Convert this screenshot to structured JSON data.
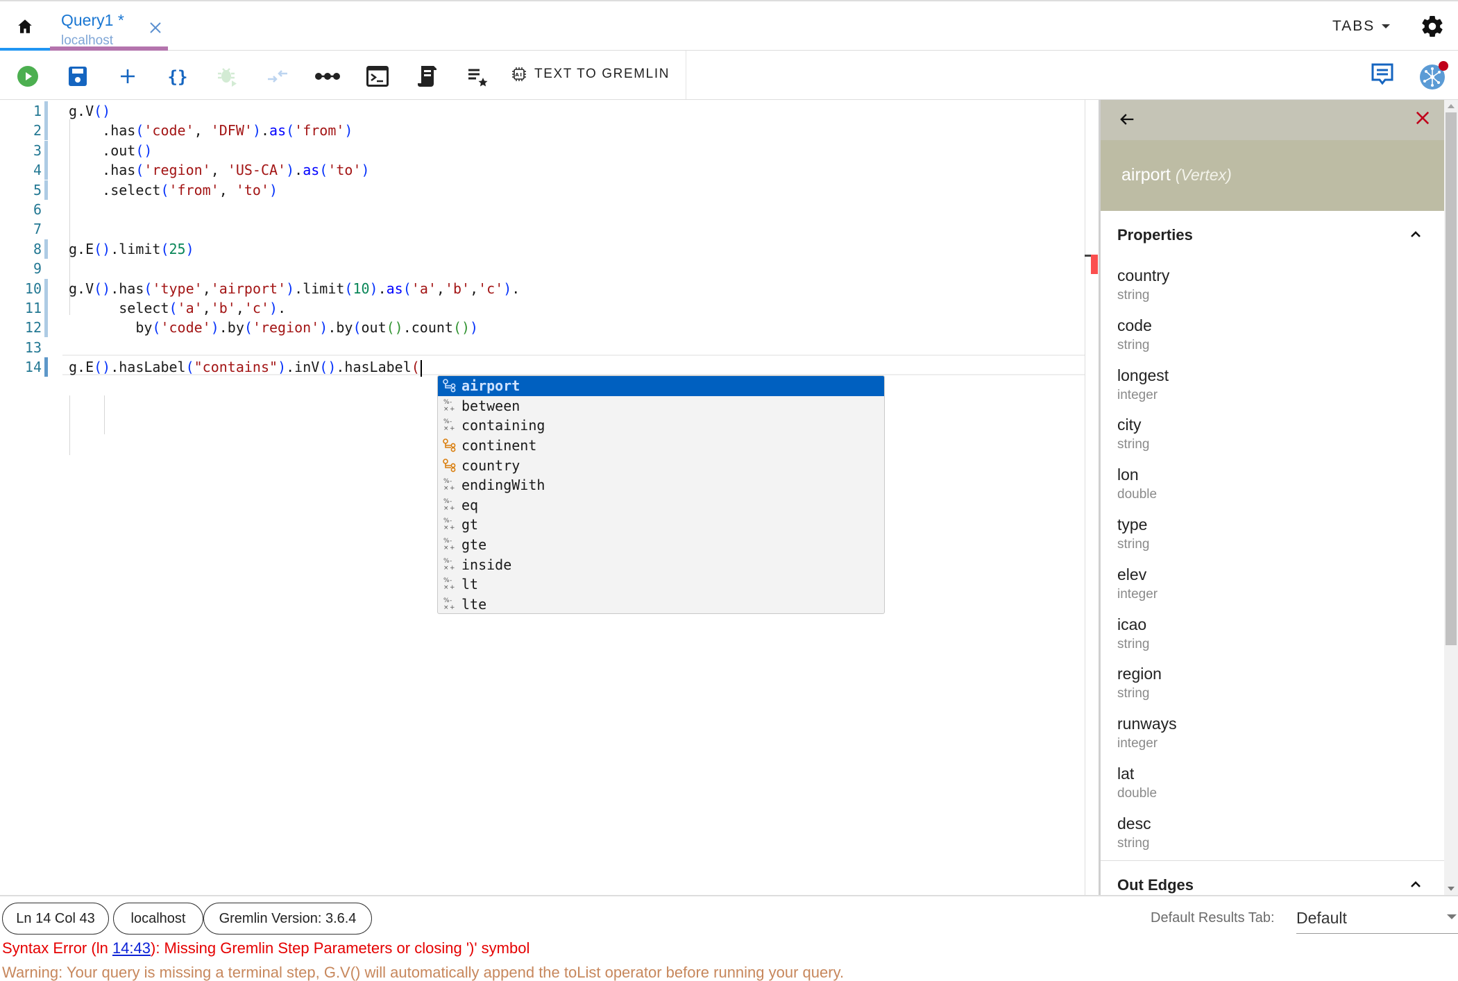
{
  "tabs": {
    "home_icon": "home-icon",
    "query_tab": {
      "title": "Query1 *",
      "subtitle": "localhost",
      "close_icon": "close-icon"
    },
    "tabs_menu_label": "TABS",
    "settings_icon": "gear-icon"
  },
  "toolbar": {
    "buttons": [
      {
        "name": "run",
        "icon": "play-circle-icon",
        "color": "#4caf50"
      },
      {
        "name": "save",
        "icon": "floppy-disk-icon",
        "color": "#1565c0"
      },
      {
        "name": "add",
        "icon": "plus-icon",
        "color": "#1565c0"
      },
      {
        "name": "format",
        "icon": "curly-braces-icon",
        "color": "#1565c0"
      },
      {
        "name": "debug",
        "icon": "bug-play-icon",
        "color": "#cfe8d0",
        "disabled": true
      },
      {
        "name": "collapse",
        "icon": "compress-arrows-icon",
        "color": "#bcd4f0",
        "disabled": true
      },
      {
        "name": "more",
        "icon": "dots-connected-icon",
        "color": "#222222"
      },
      {
        "name": "console",
        "icon": "terminal-icon",
        "color": "#222222"
      },
      {
        "name": "script",
        "icon": "scroll-icon",
        "color": "#222222"
      },
      {
        "name": "favorites",
        "icon": "list-star-icon",
        "color": "#222222"
      }
    ],
    "text_to_gremlin_label": "TEXT TO GREMLIN",
    "text_to_gremlin_icon": "ai-chip-icon",
    "feedback_icon": "chat-icon",
    "graph_icon": "graph-network-icon",
    "graph_badge_color": "#c0001a"
  },
  "editor": {
    "lines": [
      {
        "n": "1",
        "tokens": [
          [
            "g.V",
            ""
          ],
          [
            "(",
            "p1"
          ],
          [
            ")",
            "p1"
          ]
        ]
      },
      {
        "n": "2",
        "tokens": [
          [
            "    .has",
            ""
          ],
          [
            "(",
            "p1"
          ],
          [
            "'code'",
            "str"
          ],
          [
            ", ",
            ""
          ],
          [
            "'DFW'",
            "str"
          ],
          [
            ")",
            "p1"
          ],
          [
            ".",
            ""
          ],
          [
            "as",
            "fn"
          ],
          [
            "(",
            "p1"
          ],
          [
            "'from'",
            "str"
          ],
          [
            ")",
            "p1"
          ]
        ]
      },
      {
        "n": "3",
        "tokens": [
          [
            "    .out",
            ""
          ],
          [
            "(",
            "p1"
          ],
          [
            ")",
            "p1"
          ]
        ]
      },
      {
        "n": "4",
        "tokens": [
          [
            "    .has",
            ""
          ],
          [
            "(",
            "p1"
          ],
          [
            "'region'",
            "str"
          ],
          [
            ", ",
            ""
          ],
          [
            "'US-CA'",
            "str"
          ],
          [
            ")",
            "p1"
          ],
          [
            ".",
            ""
          ],
          [
            "as",
            "fn"
          ],
          [
            "(",
            "p1"
          ],
          [
            "'to'",
            "str"
          ],
          [
            ")",
            "p1"
          ]
        ]
      },
      {
        "n": "5",
        "tokens": [
          [
            "    .select",
            ""
          ],
          [
            "(",
            "p1"
          ],
          [
            "'from'",
            "str"
          ],
          [
            ", ",
            ""
          ],
          [
            "'to'",
            "str"
          ],
          [
            ")",
            "p1"
          ]
        ]
      },
      {
        "n": "6",
        "tokens": []
      },
      {
        "n": "7",
        "tokens": []
      },
      {
        "n": "8",
        "tokens": [
          [
            "g.E",
            ""
          ],
          [
            "(",
            "p1"
          ],
          [
            ")",
            "p1"
          ],
          [
            ".limit",
            ""
          ],
          [
            "(",
            "p1"
          ],
          [
            "25",
            "num"
          ],
          [
            ")",
            "p1"
          ]
        ]
      },
      {
        "n": "9",
        "tokens": []
      },
      {
        "n": "10",
        "tokens": [
          [
            "g.V",
            ""
          ],
          [
            "(",
            "p1"
          ],
          [
            ")",
            "p1"
          ],
          [
            ".has",
            ""
          ],
          [
            "(",
            "p1"
          ],
          [
            "'type'",
            "str"
          ],
          [
            ",",
            ""
          ],
          [
            "'airport'",
            "str"
          ],
          [
            ")",
            "p1"
          ],
          [
            ".limit",
            ""
          ],
          [
            "(",
            "p1"
          ],
          [
            "10",
            "num"
          ],
          [
            ")",
            "p1"
          ],
          [
            ".",
            ""
          ],
          [
            "as",
            "fn"
          ],
          [
            "(",
            "p1"
          ],
          [
            "'a'",
            "str"
          ],
          [
            ",",
            ""
          ],
          [
            "'b'",
            "str"
          ],
          [
            ",",
            ""
          ],
          [
            "'c'",
            "str"
          ],
          [
            ")",
            "p1"
          ],
          [
            ".",
            ""
          ]
        ]
      },
      {
        "n": "11",
        "tokens": [
          [
            "      select",
            ""
          ],
          [
            "(",
            "p1"
          ],
          [
            "'a'",
            "str"
          ],
          [
            ",",
            ""
          ],
          [
            "'b'",
            "str"
          ],
          [
            ",",
            ""
          ],
          [
            "'c'",
            "str"
          ],
          [
            ")",
            "p1"
          ],
          [
            ".",
            ""
          ]
        ]
      },
      {
        "n": "12",
        "tokens": [
          [
            "        by",
            ""
          ],
          [
            "(",
            "p1"
          ],
          [
            "'code'",
            "str"
          ],
          [
            ")",
            "p1"
          ],
          [
            ".by",
            ""
          ],
          [
            "(",
            "p1"
          ],
          [
            "'region'",
            "str"
          ],
          [
            ")",
            "p1"
          ],
          [
            ".by",
            ""
          ],
          [
            "(",
            "p1"
          ],
          [
            "out",
            ""
          ],
          [
            "(",
            "p2"
          ],
          [
            ")",
            "p2"
          ],
          [
            ".count",
            ""
          ],
          [
            "(",
            "p2"
          ],
          [
            ")",
            "p2"
          ],
          [
            ")",
            "p1"
          ]
        ]
      },
      {
        "n": "13",
        "tokens": []
      },
      {
        "n": "14",
        "tokens": [
          [
            "g.E",
            ""
          ],
          [
            "(",
            "p1"
          ],
          [
            ")",
            "p1"
          ],
          [
            ".hasLabel",
            ""
          ],
          [
            "(",
            "p1"
          ],
          [
            "\"contains\"",
            "str"
          ],
          [
            ")",
            "p1"
          ],
          [
            ".inV",
            ""
          ],
          [
            "(",
            "p1"
          ],
          [
            ")",
            "p1"
          ],
          [
            ".hasLabel",
            ""
          ],
          [
            "(",
            "str"
          ]
        ]
      }
    ],
    "cursor_line": "14",
    "autocomplete": [
      {
        "label": "airport",
        "kind": "label",
        "selected": true
      },
      {
        "label": "between",
        "kind": "operator"
      },
      {
        "label": "containing",
        "kind": "operator"
      },
      {
        "label": "continent",
        "kind": "label"
      },
      {
        "label": "country",
        "kind": "label"
      },
      {
        "label": "endingWith",
        "kind": "operator"
      },
      {
        "label": "eq",
        "kind": "operator"
      },
      {
        "label": "gt",
        "kind": "operator"
      },
      {
        "label": "gte",
        "kind": "operator"
      },
      {
        "label": "inside",
        "kind": "operator"
      },
      {
        "label": "lt",
        "kind": "operator"
      },
      {
        "label": "lte",
        "kind": "operator"
      }
    ]
  },
  "details_panel": {
    "back_icon": "arrow-left-icon",
    "close_icon": "close-icon",
    "title": "airport",
    "title_kind": "(Vertex)",
    "header_color": "#c5c4b6",
    "title_bg_color": "#bdbca4",
    "properties_label": "Properties",
    "properties": [
      {
        "name": "country",
        "type": "string"
      },
      {
        "name": "code",
        "type": "string"
      },
      {
        "name": "longest",
        "type": "integer"
      },
      {
        "name": "city",
        "type": "string"
      },
      {
        "name": "lon",
        "type": "double"
      },
      {
        "name": "type",
        "type": "string"
      },
      {
        "name": "elev",
        "type": "integer"
      },
      {
        "name": "icao",
        "type": "string"
      },
      {
        "name": "region",
        "type": "string"
      },
      {
        "name": "runways",
        "type": "integer"
      },
      {
        "name": "lat",
        "type": "double"
      },
      {
        "name": "desc",
        "type": "string"
      }
    ],
    "out_edges_label": "Out Edges"
  },
  "status": {
    "position": "Ln 14 Col 43",
    "host": "localhost",
    "gremlin_version": "Gremlin Version: 3.6.4",
    "default_results_tab_label": "Default Results Tab:",
    "default_results_tab_value": "Default",
    "error_prefix": "Syntax Error (ln ",
    "error_location": "14:43",
    "error_suffix": "): Missing Gremlin Step Parameters or closing ')' symbol",
    "warning": "Warning: Your query is missing a terminal step, G.V() will automatically append the toList operator before running your query."
  }
}
